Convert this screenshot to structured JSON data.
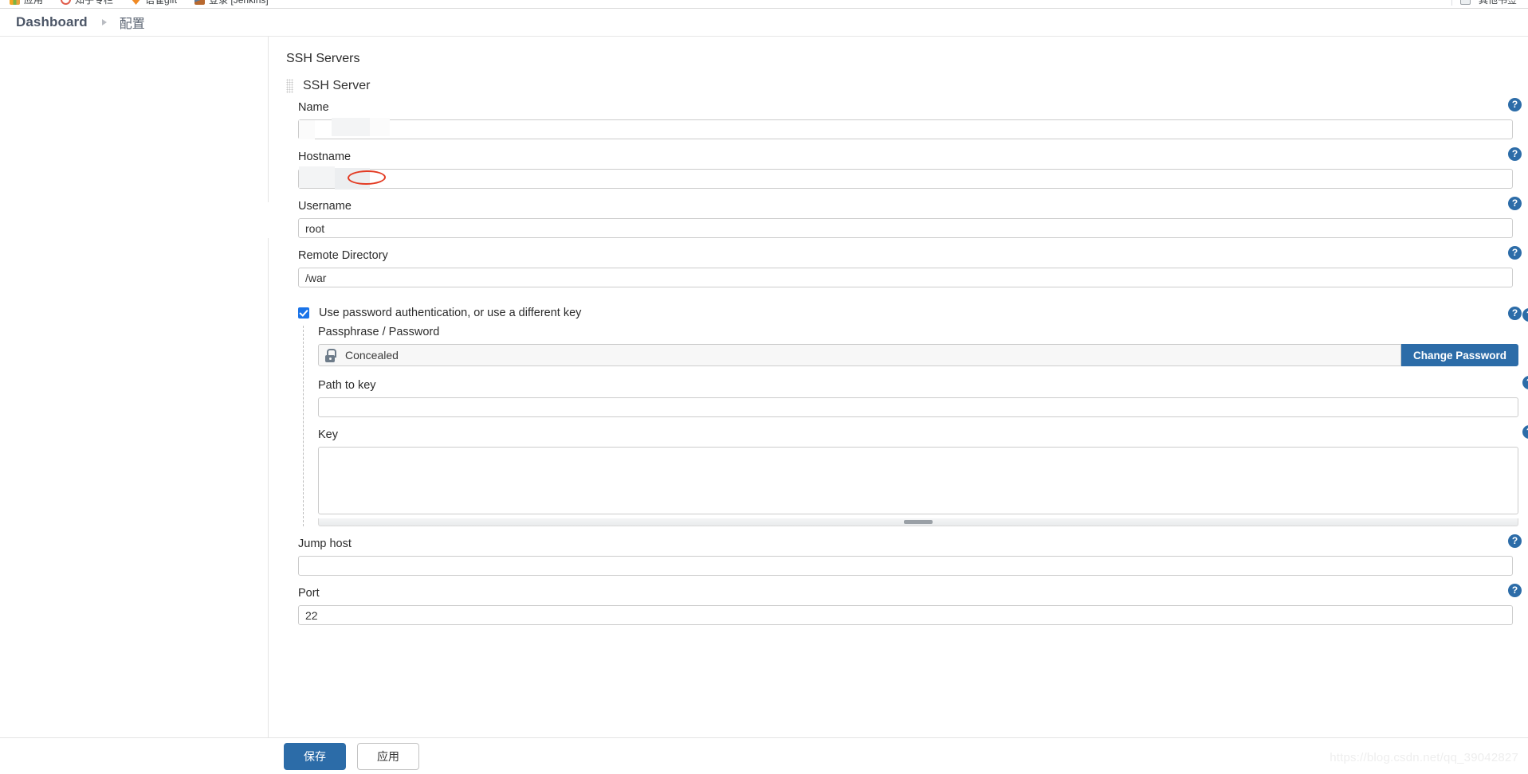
{
  "browser": {
    "bookmarks": [
      {
        "label": "应用",
        "icon": "grid-favicon"
      },
      {
        "label": "知乎专栏",
        "icon": "circle-favicon"
      },
      {
        "label": "语雀gift",
        "icon": "heart-favicon"
      },
      {
        "label": "登录 [Jenkins]",
        "icon": "image-favicon"
      }
    ],
    "bookmarks_right": [
      {
        "label": "其他书签",
        "icon": "folder-favicon"
      }
    ]
  },
  "breadcrumb": {
    "home": "Dashboard",
    "separator": "triangle-right-icon",
    "current": "配置"
  },
  "main": {
    "section_title": "SSH Servers",
    "server": {
      "grip_icon": "drag-handle-icon",
      "title": "SSH Server"
    },
    "help_icon": "help-question-icon",
    "fields": [
      {
        "label": "Name",
        "value": "",
        "placeholder": "",
        "redacted": true,
        "help": "?"
      },
      {
        "label": "Hostname",
        "value": "",
        "placeholder": "",
        "redacted": true,
        "help": "?",
        "annotation": "red-ellipse"
      },
      {
        "label": "Username",
        "value": "root",
        "placeholder": "",
        "redacted": false,
        "help": "?"
      },
      {
        "label": "Remote Directory",
        "value": "/war",
        "placeholder": "",
        "redacted": false,
        "help": "?"
      }
    ],
    "password_auth": {
      "checked": true,
      "checkbox_label": "Use password authentication, or use a different key",
      "help": "?",
      "nested_help": "?",
      "passphrase": {
        "label": "Passphrase / Password",
        "lock_icon": "padlock-icon",
        "value": "Concealed",
        "change_button": "Change Password"
      },
      "path_to_key": {
        "label": "Path to key",
        "value": "",
        "placeholder": "",
        "help": "?"
      },
      "key": {
        "label": "Key",
        "value": "",
        "placeholder": "",
        "help": "?",
        "scroll_icon": "resize-handle-icon"
      }
    },
    "jump_host": {
      "label": "Jump host",
      "value": "",
      "placeholder": "",
      "help": "?"
    },
    "port": {
      "label": "Port",
      "value": "22",
      "placeholder": "",
      "help": "?"
    }
  },
  "footer": {
    "save_label": "保存",
    "apply_label": "应用"
  },
  "watermark": "https://blog.csdn.net/qq_39042827",
  "colors": {
    "accent_blue": "#2c6ca8",
    "checkbox_blue": "#1a73e8",
    "annotation_red": "#e33b23",
    "help_blue": "#2c6ca8"
  }
}
